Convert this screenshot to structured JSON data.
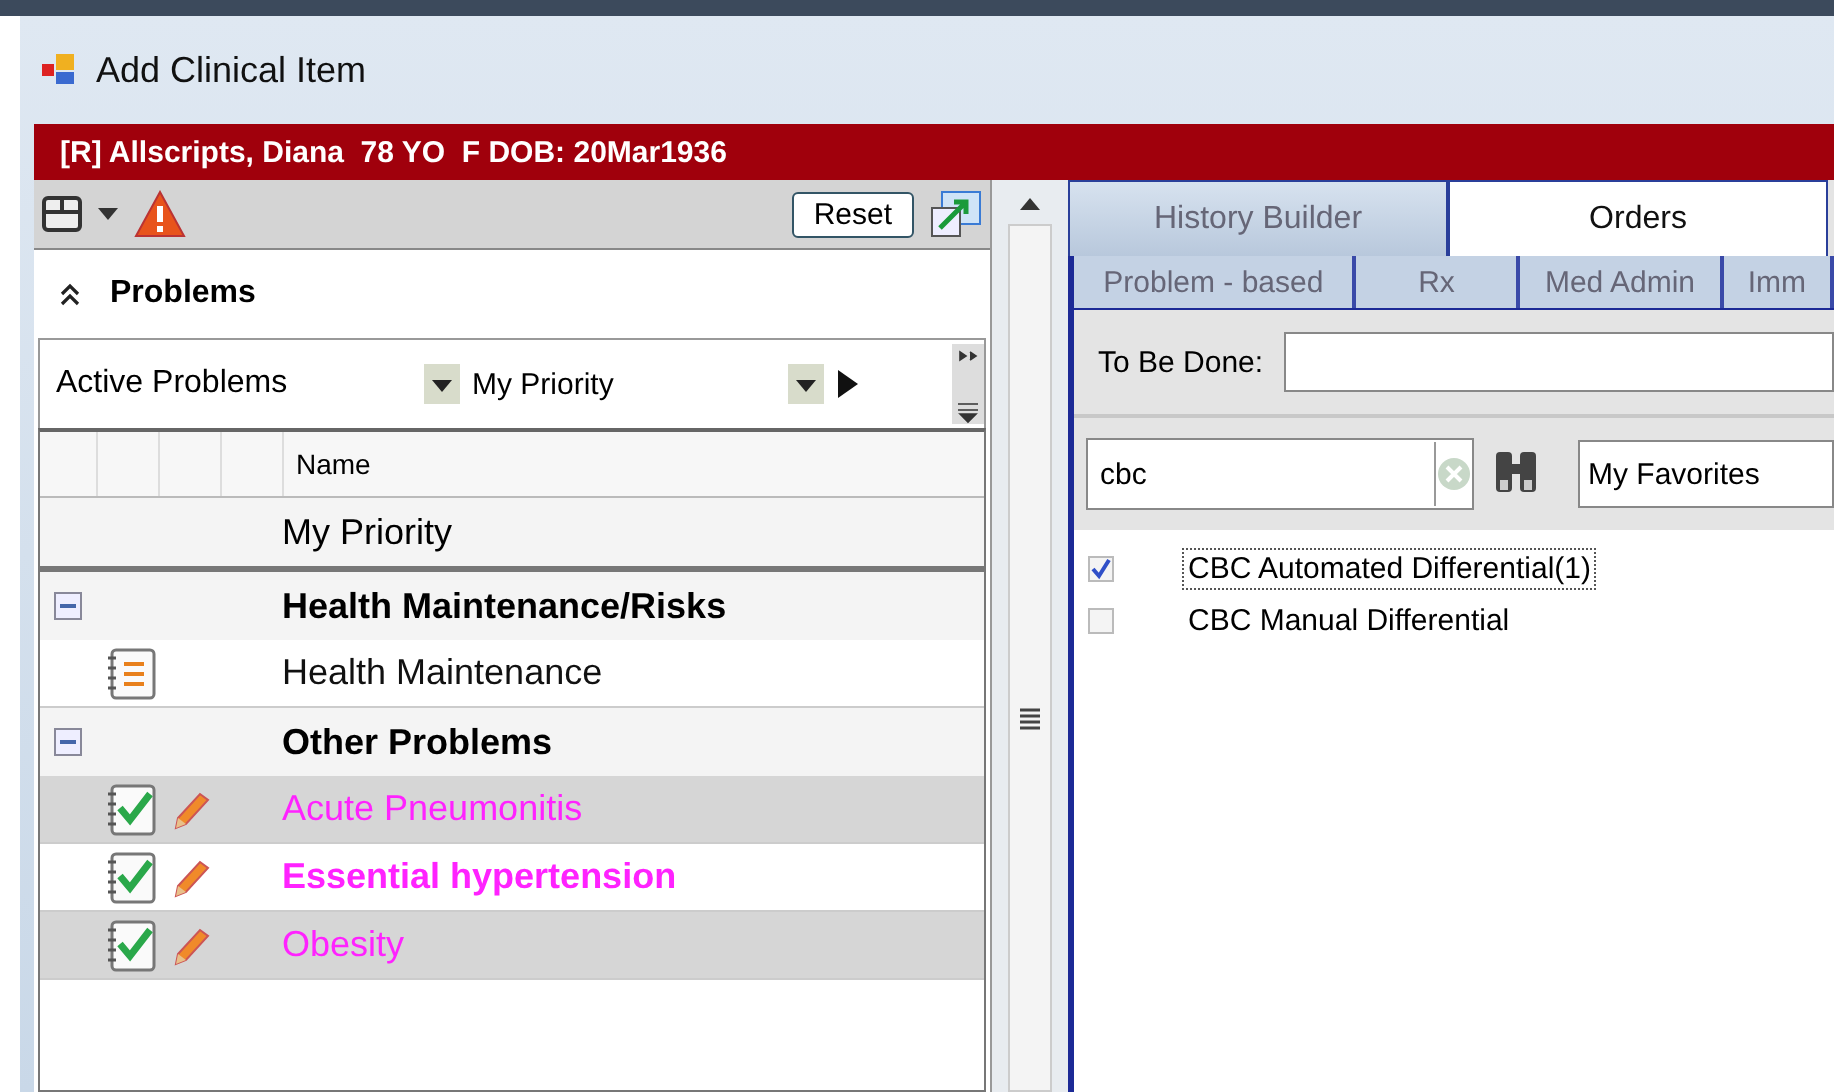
{
  "window": {
    "title": "Add Clinical Item"
  },
  "patient_banner": "[R] Allscripts, Diana  78 YO  F DOB: 20Mar1936",
  "left": {
    "reset_button": "Reset",
    "section_title": "Problems",
    "section_expanded": true,
    "filters": [
      "Active Problems",
      "My Priority"
    ],
    "column_header": "Name",
    "rows": [
      {
        "kind": "priority",
        "label": "My Priority"
      },
      {
        "kind": "group",
        "label": "Health Maintenance/Risks",
        "expanded": true
      },
      {
        "kind": "note",
        "label": "Health Maintenance",
        "selected": false,
        "bold": false
      },
      {
        "kind": "group",
        "label": "Other Problems",
        "expanded": true
      },
      {
        "kind": "problem",
        "label": "Acute Pneumonitis",
        "selected": true,
        "bold": false,
        "color": "#ff22ff"
      },
      {
        "kind": "problem",
        "label": "Essential hypertension",
        "selected": false,
        "bold": true,
        "color": "#ff22ff"
      },
      {
        "kind": "problem",
        "label": "Obesity",
        "selected": true,
        "bold": false,
        "color": "#ff22ff"
      }
    ]
  },
  "right": {
    "tabs": [
      {
        "label": "History Builder",
        "selected": false
      },
      {
        "label": "Orders",
        "selected": true
      }
    ],
    "subtabs": [
      "Problem - based",
      "Rx",
      "Med Admin",
      "Imm"
    ],
    "to_be_done_label": "To Be Done:",
    "search": {
      "value": "cbc"
    },
    "list_dropdown": "My Favorites",
    "results": [
      {
        "label": "CBC Automated Differential(1)",
        "checked": true,
        "focused": true
      },
      {
        "label": "CBC Manual Differential",
        "checked": false,
        "focused": false
      }
    ]
  }
}
